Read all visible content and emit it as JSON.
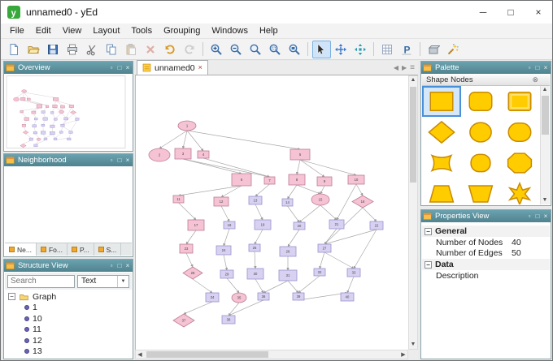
{
  "window": {
    "title": "unnamed0 - yEd",
    "controls": {
      "minimize": "minimize",
      "maximize": "maximize",
      "close": "close"
    }
  },
  "menu": {
    "items": [
      "File",
      "Edit",
      "View",
      "Layout",
      "Tools",
      "Grouping",
      "Windows",
      "Help"
    ]
  },
  "toolbar": {
    "buttons": [
      {
        "name": "new"
      },
      {
        "name": "open"
      },
      {
        "name": "save"
      },
      {
        "name": "print"
      },
      {
        "name": "cut"
      },
      {
        "name": "copy"
      },
      {
        "name": "paste",
        "disabled": true
      },
      {
        "name": "delete",
        "disabled": true
      },
      {
        "name": "undo"
      },
      {
        "name": "redo",
        "disabled": true
      },
      {
        "type": "sep"
      },
      {
        "name": "zoom-in"
      },
      {
        "name": "zoom-out"
      },
      {
        "name": "zoom-reset"
      },
      {
        "name": "zoom-area"
      },
      {
        "name": "fit-content"
      },
      {
        "type": "sep"
      },
      {
        "name": "edit-mode",
        "active": true
      },
      {
        "name": "pan-mode"
      },
      {
        "name": "move-mode"
      },
      {
        "type": "sep"
      },
      {
        "name": "grid"
      },
      {
        "name": "snap-lines"
      },
      {
        "type": "sep"
      },
      {
        "name": "group-nodes"
      },
      {
        "name": "layout-wand"
      }
    ]
  },
  "panels": {
    "overview": {
      "title": "Overview"
    },
    "neighborhood": {
      "title": "Neighborhood",
      "tabs": [
        {
          "label": "Ne...",
          "active": true
        },
        {
          "label": "Fo..."
        },
        {
          "label": "P..."
        },
        {
          "label": "S..."
        }
      ]
    },
    "structure": {
      "title": "Structure View",
      "search_placeholder": "Search",
      "filter_value": "Text",
      "tree": {
        "root": "Graph",
        "children": [
          "1",
          "10",
          "11",
          "12",
          "13"
        ]
      }
    },
    "palette": {
      "title": "Palette",
      "section": "Shape Nodes",
      "selected_index": 0,
      "fill": "#FFCC00",
      "stroke": "#C98B00",
      "shapes": [
        "rectangle",
        "round-rectangle",
        "bevel-rectangle",
        "diamond",
        "ellipse",
        "barrel",
        "wavy-rectangle",
        "rounded-square",
        "octagon",
        "trapezoid",
        "trapezoid-down",
        "star"
      ]
    },
    "properties": {
      "title": "Properties View",
      "groups": [
        {
          "label": "General",
          "rows": [
            {
              "label": "Number of Nodes",
              "value": "40"
            },
            {
              "label": "Number of Edges",
              "value": "50"
            }
          ]
        },
        {
          "label": "Data",
          "rows": [
            {
              "label": "Description",
              "value": ""
            }
          ]
        }
      ]
    }
  },
  "editor": {
    "tab_label": "unnamed0"
  },
  "graph": {
    "colors": {
      "pink_fill": "#f5c3d4",
      "pink_stroke": "#bd7d96",
      "lav_fill": "#d8d1f2",
      "lav_stroke": "#9a92cc",
      "edge": "#a8a8a8"
    },
    "nodes": [
      [
        52,
        56,
        22,
        12,
        1,
        0
      ],
      [
        16,
        90,
        26,
        16,
        1,
        0
      ],
      [
        48,
        90,
        20,
        13,
        0,
        0
      ],
      [
        76,
        93,
        14,
        9,
        0,
        0
      ],
      [
        190,
        91,
        24,
        13,
        0,
        0
      ],
      [
        118,
        121,
        24,
        15,
        0,
        0
      ],
      [
        158,
        125,
        13,
        9,
        0,
        0
      ],
      [
        188,
        122,
        20,
        13,
        0,
        0
      ],
      [
        223,
        125,
        18,
        11,
        0,
        0
      ],
      [
        261,
        123,
        20,
        11,
        0,
        0
      ],
      [
        46,
        148,
        13,
        9,
        0,
        0
      ],
      [
        96,
        150,
        18,
        11,
        0,
        0
      ],
      [
        139,
        149,
        16,
        10,
        0,
        1
      ],
      [
        180,
        152,
        13,
        9,
        0,
        1
      ],
      [
        216,
        146,
        22,
        14,
        1,
        0
      ],
      [
        266,
        148,
        26,
        15,
        2,
        0
      ],
      [
        64,
        178,
        20,
        13,
        0,
        0
      ],
      [
        108,
        180,
        14,
        9,
        0,
        1
      ],
      [
        146,
        178,
        20,
        12,
        0,
        1
      ],
      [
        194,
        181,
        14,
        9,
        0,
        1
      ],
      [
        238,
        178,
        18,
        11,
        0,
        1
      ],
      [
        288,
        180,
        16,
        10,
        0,
        1
      ],
      [
        54,
        208,
        16,
        11,
        0,
        0
      ],
      [
        99,
        210,
        18,
        11,
        0,
        1
      ],
      [
        139,
        208,
        14,
        9,
        0,
        1
      ],
      [
        177,
        211,
        20,
        12,
        0,
        1
      ],
      [
        224,
        208,
        16,
        10,
        0,
        1
      ],
      [
        58,
        236,
        24,
        15,
        2,
        0
      ],
      [
        104,
        240,
        16,
        10,
        0,
        1
      ],
      [
        137,
        238,
        20,
        13,
        0,
        1
      ],
      [
        176,
        240,
        22,
        13,
        0,
        1
      ],
      [
        219,
        238,
        14,
        9,
        0,
        1
      ],
      [
        260,
        238,
        16,
        10,
        0,
        1
      ],
      [
        86,
        268,
        16,
        11,
        0,
        1
      ],
      [
        118,
        268,
        18,
        12,
        1,
        0
      ],
      [
        150,
        268,
        14,
        9,
        0,
        1
      ],
      [
        46,
        294,
        26,
        16,
        2,
        0
      ],
      [
        106,
        296,
        16,
        10,
        0,
        1
      ],
      [
        193,
        268,
        14,
        9,
        0,
        1
      ],
      [
        252,
        268,
        16,
        10,
        0,
        1
      ]
    ],
    "edges": [
      [
        0,
        1
      ],
      [
        0,
        2
      ],
      [
        0,
        3
      ],
      [
        0,
        4
      ],
      [
        2,
        5
      ],
      [
        2,
        6
      ],
      [
        3,
        6
      ],
      [
        4,
        7
      ],
      [
        4,
        8
      ],
      [
        4,
        9
      ],
      [
        5,
        10
      ],
      [
        5,
        11
      ],
      [
        6,
        12
      ],
      [
        7,
        13
      ],
      [
        7,
        14
      ],
      [
        8,
        14
      ],
      [
        9,
        15
      ],
      [
        9,
        20
      ],
      [
        10,
        16
      ],
      [
        11,
        17
      ],
      [
        12,
        18
      ],
      [
        13,
        19
      ],
      [
        14,
        20
      ],
      [
        15,
        21
      ],
      [
        14,
        19
      ],
      [
        16,
        22
      ],
      [
        17,
        23
      ],
      [
        18,
        24
      ],
      [
        19,
        25
      ],
      [
        20,
        26
      ],
      [
        21,
        26
      ],
      [
        15,
        26
      ],
      [
        22,
        27
      ],
      [
        23,
        28
      ],
      [
        24,
        29
      ],
      [
        25,
        30
      ],
      [
        26,
        31
      ],
      [
        26,
        32
      ],
      [
        21,
        32
      ],
      [
        27,
        33
      ],
      [
        28,
        34
      ],
      [
        29,
        35
      ],
      [
        30,
        35
      ],
      [
        30,
        38
      ],
      [
        32,
        39
      ],
      [
        31,
        38
      ],
      [
        33,
        36
      ],
      [
        34,
        37
      ],
      [
        35,
        37
      ],
      [
        38,
        39
      ]
    ]
  }
}
